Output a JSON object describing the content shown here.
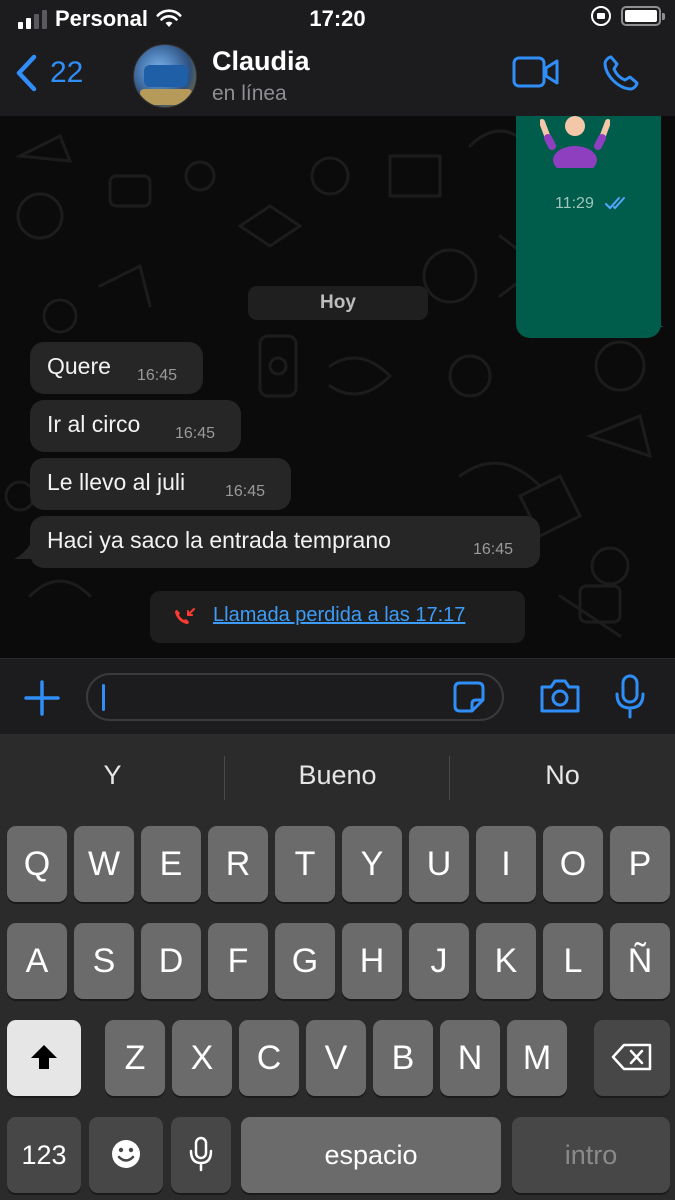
{
  "status_bar": {
    "carrier": "Personal",
    "time": "17:20"
  },
  "header": {
    "back_count": "22",
    "contact_name": "Claudia",
    "contact_status": "en línea"
  },
  "chat": {
    "outgoing": {
      "time": "11:29"
    },
    "day_separator": "Hoy",
    "incoming_messages": [
      {
        "text": "Quere",
        "time": "16:45"
      },
      {
        "text": "Ir al circo",
        "time": "16:45"
      },
      {
        "text": "Le llevo al juli",
        "time": "16:45"
      },
      {
        "text": "Haci ya saco la entrada temprano",
        "time": "16:45"
      }
    ],
    "missed_call": "Llamada perdida a las 17:17"
  },
  "input": {
    "value": ""
  },
  "keyboard": {
    "predictions": [
      "Y",
      "Bueno",
      "No"
    ],
    "row1": [
      "Q",
      "W",
      "E",
      "R",
      "T",
      "Y",
      "U",
      "I",
      "O",
      "P"
    ],
    "row2": [
      "A",
      "S",
      "D",
      "F",
      "G",
      "H",
      "J",
      "K",
      "L",
      "Ñ"
    ],
    "row3": [
      "Z",
      "X",
      "C",
      "V",
      "B",
      "N",
      "M"
    ],
    "numbers_key": "123",
    "space_key": "espacio",
    "return_key": "intro"
  },
  "colors": {
    "accent": "#2f8ef7",
    "outgoing_bubble": "#005c4b",
    "incoming_bubble": "#262626",
    "missed_call_icon": "#ff3b30"
  }
}
